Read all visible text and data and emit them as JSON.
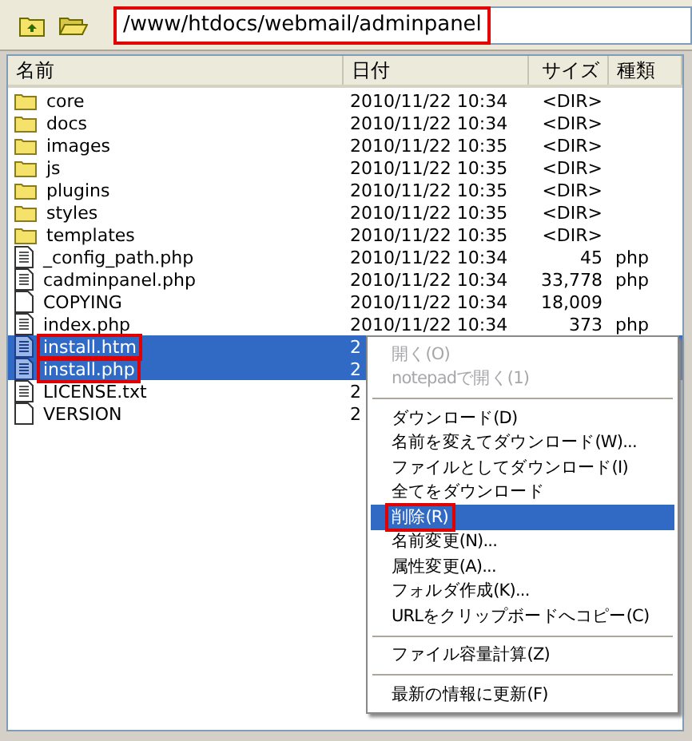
{
  "toolbar": {
    "path": "/www/htdocs/webmail/adminpanel",
    "path_highlighted": true
  },
  "columns": [
    "名前",
    "日付",
    "サイズ",
    "種類"
  ],
  "rows": [
    {
      "kind": "folder",
      "name": "core",
      "date": "2010/11/22 10:34",
      "size": "<DIR>",
      "type": "",
      "selected": false,
      "highlighted": false
    },
    {
      "kind": "folder",
      "name": "docs",
      "date": "2010/11/22 10:34",
      "size": "<DIR>",
      "type": "",
      "selected": false,
      "highlighted": false
    },
    {
      "kind": "folder",
      "name": "images",
      "date": "2010/11/22 10:35",
      "size": "<DIR>",
      "type": "",
      "selected": false,
      "highlighted": false
    },
    {
      "kind": "folder",
      "name": "js",
      "date": "2010/11/22 10:35",
      "size": "<DIR>",
      "type": "",
      "selected": false,
      "highlighted": false
    },
    {
      "kind": "folder",
      "name": "plugins",
      "date": "2010/11/22 10:35",
      "size": "<DIR>",
      "type": "",
      "selected": false,
      "highlighted": false
    },
    {
      "kind": "folder",
      "name": "styles",
      "date": "2010/11/22 10:35",
      "size": "<DIR>",
      "type": "",
      "selected": false,
      "highlighted": false
    },
    {
      "kind": "folder",
      "name": "templates",
      "date": "2010/11/22 10:35",
      "size": "<DIR>",
      "type": "",
      "selected": false,
      "highlighted": false
    },
    {
      "kind": "text",
      "name": "_config_path.php",
      "date": "2010/11/22 10:34",
      "size": "45",
      "type": "php",
      "selected": false,
      "highlighted": false
    },
    {
      "kind": "text",
      "name": "cadminpanel.php",
      "date": "2010/11/22 10:34",
      "size": "33,778",
      "type": "php",
      "selected": false,
      "highlighted": false
    },
    {
      "kind": "blank",
      "name": "COPYING",
      "date": "2010/11/22 10:34",
      "size": "18,009",
      "type": "",
      "selected": false,
      "highlighted": false
    },
    {
      "kind": "text",
      "name": "index.php",
      "date": "2010/11/22 10:34",
      "size": "373",
      "type": "php",
      "selected": false,
      "highlighted": false
    },
    {
      "kind": "text",
      "name": "install.htm",
      "date": "2",
      "size": "",
      "type": "",
      "selected": true,
      "highlighted": true
    },
    {
      "kind": "text",
      "name": "install.php",
      "date": "2",
      "size": "",
      "type": "",
      "selected": true,
      "highlighted": true
    },
    {
      "kind": "text",
      "name": "LICENSE.txt",
      "date": "2",
      "size": "",
      "type": "",
      "selected": false,
      "highlighted": false
    },
    {
      "kind": "blank",
      "name": "VERSION",
      "date": "2",
      "size": "",
      "type": "",
      "selected": false,
      "highlighted": false
    }
  ],
  "context_menu": [
    {
      "kind": "item",
      "label": "開く(O)",
      "disabled": true,
      "selected": false,
      "highlighted": false
    },
    {
      "kind": "item",
      "label": "notepadで開く(1)",
      "disabled": true,
      "selected": false,
      "highlighted": false
    },
    {
      "kind": "separator"
    },
    {
      "kind": "item",
      "label": "ダウンロード(D)",
      "disabled": false,
      "selected": false,
      "highlighted": false
    },
    {
      "kind": "item",
      "label": "名前を変えてダウンロード(W)...",
      "disabled": false,
      "selected": false,
      "highlighted": false
    },
    {
      "kind": "item",
      "label": "ファイルとしてダウンロード(I)",
      "disabled": false,
      "selected": false,
      "highlighted": false
    },
    {
      "kind": "item",
      "label": "全てをダウンロード",
      "disabled": false,
      "selected": false,
      "highlighted": false
    },
    {
      "kind": "item",
      "label": "削除(R)",
      "disabled": false,
      "selected": true,
      "highlighted": true
    },
    {
      "kind": "item",
      "label": "名前変更(N)...",
      "disabled": false,
      "selected": false,
      "highlighted": false
    },
    {
      "kind": "item",
      "label": "属性変更(A)...",
      "disabled": false,
      "selected": false,
      "highlighted": false
    },
    {
      "kind": "item",
      "label": "フォルダ作成(K)...",
      "disabled": false,
      "selected": false,
      "highlighted": false
    },
    {
      "kind": "item",
      "label": "URLをクリップボードへコピー(C)",
      "disabled": false,
      "selected": false,
      "highlighted": false
    },
    {
      "kind": "separator"
    },
    {
      "kind": "item",
      "label": "ファイル容量計算(Z)",
      "disabled": false,
      "selected": false,
      "highlighted": false
    },
    {
      "kind": "separator"
    },
    {
      "kind": "item",
      "label": "最新の情報に更新(F)",
      "disabled": false,
      "selected": false,
      "highlighted": false
    }
  ]
}
